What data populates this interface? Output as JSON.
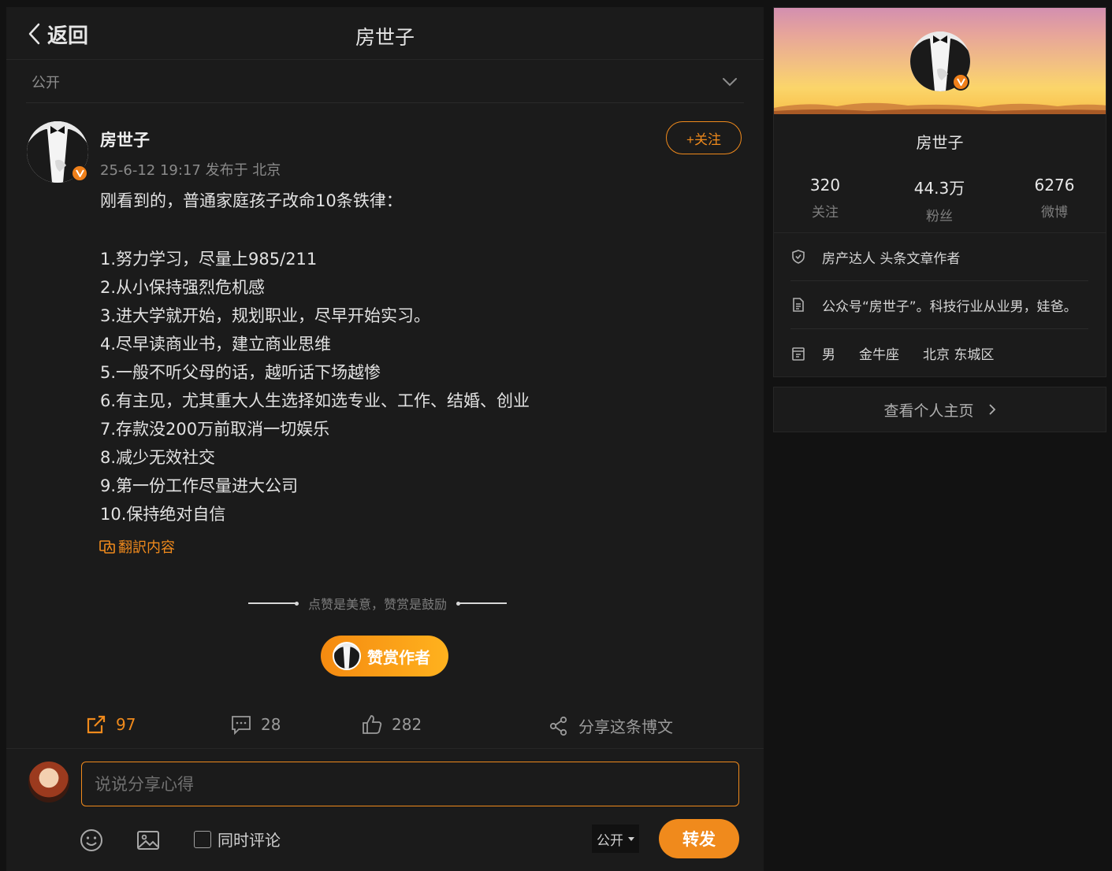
{
  "header": {
    "back_label": "返回",
    "title": "房世子"
  },
  "visibility": {
    "label": "公开"
  },
  "post": {
    "author": "房世子",
    "meta": "25-6-12 19:17 发布于 北京",
    "follow_label": "+关注",
    "headline": "刚看到的，普通家庭孩子改命10条铁律：",
    "lines": [
      "1.努力学习，尽量上985/211",
      "2.从小保持强烈危机感",
      "3.进大学就开始，规划职业，尽早开始实习。",
      "4.尽早读商业书，建立商业思维",
      "5.一般不听父母的话，越听话下场越惨",
      "6.有主见，尤其重大人生选择如选专业、工作、结婚、创业",
      "7.存款没200万前取消一切娱乐",
      "8.减少无效社交",
      "9.第一份工作尽量进大公司",
      "10.保持绝对自信"
    ],
    "translate_label": "翻訳内容",
    "reward_hint": "点赞是美意，赞赏是鼓励",
    "reward_button": "赞赏作者"
  },
  "actions": {
    "repost_count": "97",
    "comment_count": "28",
    "like_count": "282",
    "share_label": "分享这条博文"
  },
  "composer": {
    "placeholder": "说说分享心得",
    "also_comment_label": "同时评论",
    "scope_value": "公开",
    "forward_label": "转发"
  },
  "profile": {
    "name": "房世子",
    "stats": [
      {
        "value": "320",
        "label": "关注"
      },
      {
        "value": "44.3万",
        "label": "粉丝"
      },
      {
        "value": "6276",
        "label": "微博"
      }
    ],
    "badge_text": "房产达人 头条文章作者",
    "bio": "公众号“房世子”。科技行业从业男，娃爸。",
    "gender": "男",
    "zodiac": "金牛座",
    "location": "北京 东城区",
    "view_home_label": "查看个人主页"
  },
  "colors": {
    "accent": "#f08a1c",
    "background": "#121212",
    "card": "#1b1b1b"
  }
}
